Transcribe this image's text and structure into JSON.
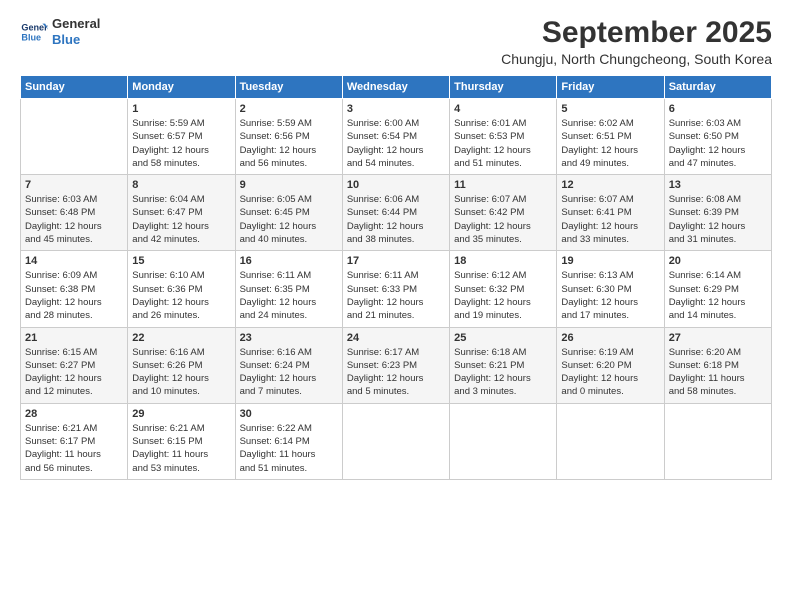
{
  "logo": {
    "line1": "General",
    "line2": "Blue"
  },
  "title": "September 2025",
  "subtitle": "Chungju, North Chungcheong, South Korea",
  "days_of_week": [
    "Sunday",
    "Monday",
    "Tuesday",
    "Wednesday",
    "Thursday",
    "Friday",
    "Saturday"
  ],
  "weeks": [
    [
      {
        "day": "",
        "info": ""
      },
      {
        "day": "1",
        "info": "Sunrise: 5:59 AM\nSunset: 6:57 PM\nDaylight: 12 hours\nand 58 minutes."
      },
      {
        "day": "2",
        "info": "Sunrise: 5:59 AM\nSunset: 6:56 PM\nDaylight: 12 hours\nand 56 minutes."
      },
      {
        "day": "3",
        "info": "Sunrise: 6:00 AM\nSunset: 6:54 PM\nDaylight: 12 hours\nand 54 minutes."
      },
      {
        "day": "4",
        "info": "Sunrise: 6:01 AM\nSunset: 6:53 PM\nDaylight: 12 hours\nand 51 minutes."
      },
      {
        "day": "5",
        "info": "Sunrise: 6:02 AM\nSunset: 6:51 PM\nDaylight: 12 hours\nand 49 minutes."
      },
      {
        "day": "6",
        "info": "Sunrise: 6:03 AM\nSunset: 6:50 PM\nDaylight: 12 hours\nand 47 minutes."
      }
    ],
    [
      {
        "day": "7",
        "info": "Sunrise: 6:03 AM\nSunset: 6:48 PM\nDaylight: 12 hours\nand 45 minutes."
      },
      {
        "day": "8",
        "info": "Sunrise: 6:04 AM\nSunset: 6:47 PM\nDaylight: 12 hours\nand 42 minutes."
      },
      {
        "day": "9",
        "info": "Sunrise: 6:05 AM\nSunset: 6:45 PM\nDaylight: 12 hours\nand 40 minutes."
      },
      {
        "day": "10",
        "info": "Sunrise: 6:06 AM\nSunset: 6:44 PM\nDaylight: 12 hours\nand 38 minutes."
      },
      {
        "day": "11",
        "info": "Sunrise: 6:07 AM\nSunset: 6:42 PM\nDaylight: 12 hours\nand 35 minutes."
      },
      {
        "day": "12",
        "info": "Sunrise: 6:07 AM\nSunset: 6:41 PM\nDaylight: 12 hours\nand 33 minutes."
      },
      {
        "day": "13",
        "info": "Sunrise: 6:08 AM\nSunset: 6:39 PM\nDaylight: 12 hours\nand 31 minutes."
      }
    ],
    [
      {
        "day": "14",
        "info": "Sunrise: 6:09 AM\nSunset: 6:38 PM\nDaylight: 12 hours\nand 28 minutes."
      },
      {
        "day": "15",
        "info": "Sunrise: 6:10 AM\nSunset: 6:36 PM\nDaylight: 12 hours\nand 26 minutes."
      },
      {
        "day": "16",
        "info": "Sunrise: 6:11 AM\nSunset: 6:35 PM\nDaylight: 12 hours\nand 24 minutes."
      },
      {
        "day": "17",
        "info": "Sunrise: 6:11 AM\nSunset: 6:33 PM\nDaylight: 12 hours\nand 21 minutes."
      },
      {
        "day": "18",
        "info": "Sunrise: 6:12 AM\nSunset: 6:32 PM\nDaylight: 12 hours\nand 19 minutes."
      },
      {
        "day": "19",
        "info": "Sunrise: 6:13 AM\nSunset: 6:30 PM\nDaylight: 12 hours\nand 17 minutes."
      },
      {
        "day": "20",
        "info": "Sunrise: 6:14 AM\nSunset: 6:29 PM\nDaylight: 12 hours\nand 14 minutes."
      }
    ],
    [
      {
        "day": "21",
        "info": "Sunrise: 6:15 AM\nSunset: 6:27 PM\nDaylight: 12 hours\nand 12 minutes."
      },
      {
        "day": "22",
        "info": "Sunrise: 6:16 AM\nSunset: 6:26 PM\nDaylight: 12 hours\nand 10 minutes."
      },
      {
        "day": "23",
        "info": "Sunrise: 6:16 AM\nSunset: 6:24 PM\nDaylight: 12 hours\nand 7 minutes."
      },
      {
        "day": "24",
        "info": "Sunrise: 6:17 AM\nSunset: 6:23 PM\nDaylight: 12 hours\nand 5 minutes."
      },
      {
        "day": "25",
        "info": "Sunrise: 6:18 AM\nSunset: 6:21 PM\nDaylight: 12 hours\nand 3 minutes."
      },
      {
        "day": "26",
        "info": "Sunrise: 6:19 AM\nSunset: 6:20 PM\nDaylight: 12 hours\nand 0 minutes."
      },
      {
        "day": "27",
        "info": "Sunrise: 6:20 AM\nSunset: 6:18 PM\nDaylight: 11 hours\nand 58 minutes."
      }
    ],
    [
      {
        "day": "28",
        "info": "Sunrise: 6:21 AM\nSunset: 6:17 PM\nDaylight: 11 hours\nand 56 minutes."
      },
      {
        "day": "29",
        "info": "Sunrise: 6:21 AM\nSunset: 6:15 PM\nDaylight: 11 hours\nand 53 minutes."
      },
      {
        "day": "30",
        "info": "Sunrise: 6:22 AM\nSunset: 6:14 PM\nDaylight: 11 hours\nand 51 minutes."
      },
      {
        "day": "",
        "info": ""
      },
      {
        "day": "",
        "info": ""
      },
      {
        "day": "",
        "info": ""
      },
      {
        "day": "",
        "info": ""
      }
    ]
  ]
}
